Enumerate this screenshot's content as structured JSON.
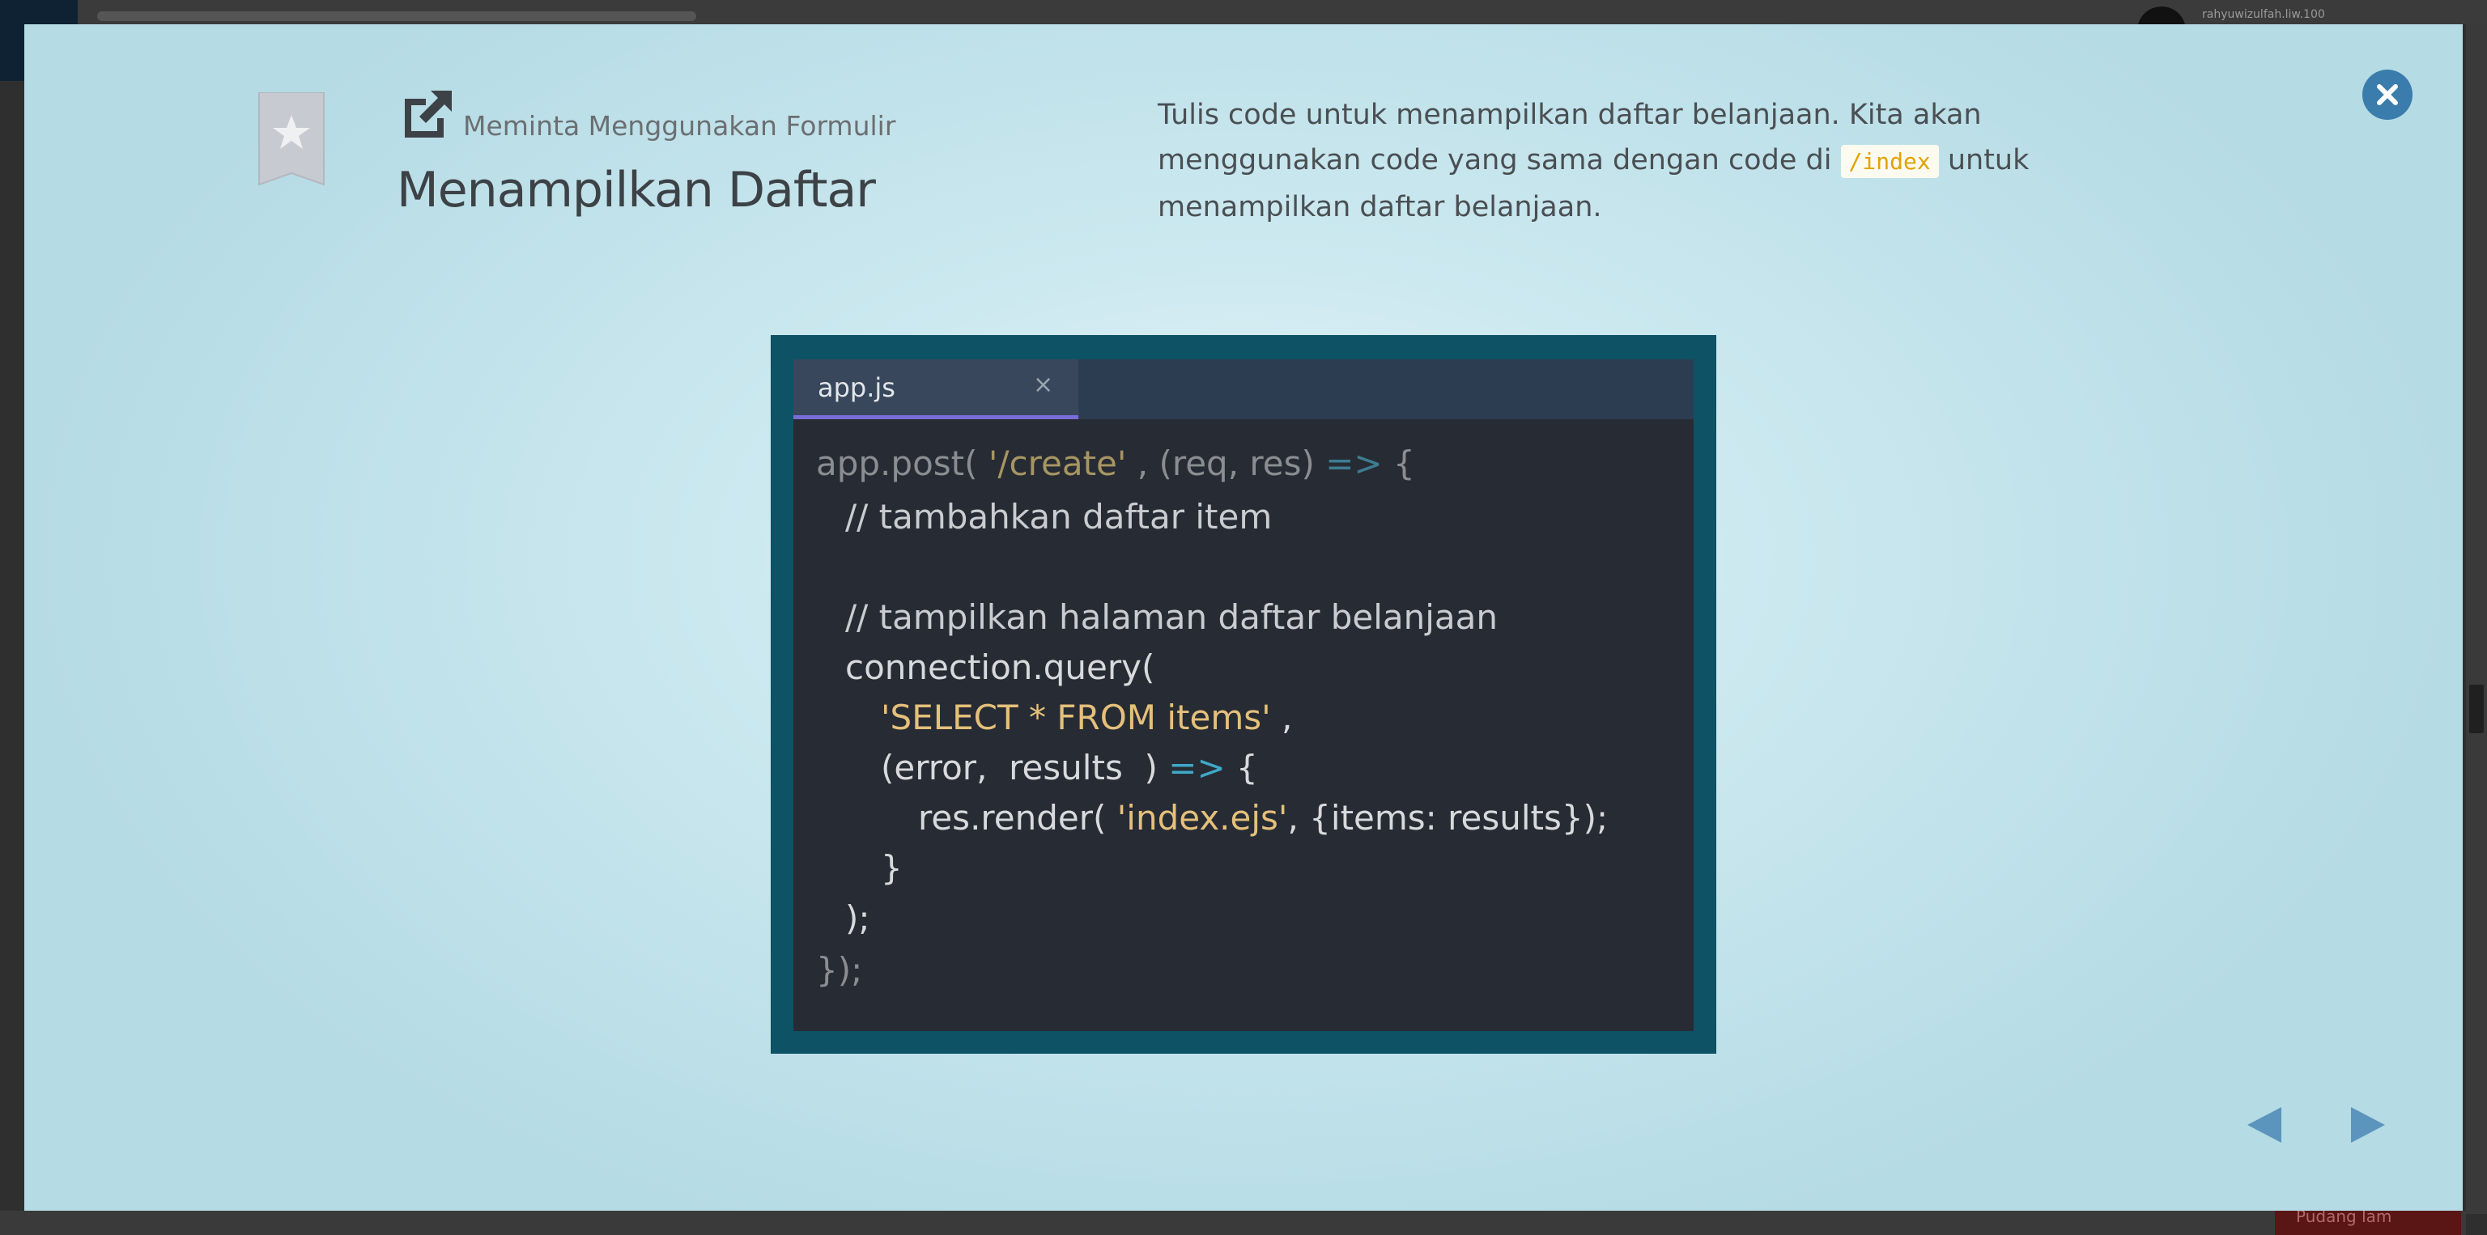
{
  "background": {
    "user_label": "rahyuwizulfah.liw.100",
    "bottom_button_label": "Pudang lam"
  },
  "lesson": {
    "subtitle": "Meminta Menggunakan Formulir",
    "title": "Menampilkan Daftar",
    "description_part1": "Tulis code untuk menampilkan daftar belanjaan. Kita akan menggunakan code yang sama dengan code di ",
    "description_code": "/index",
    "description_part2": " untuk menampilkan daftar belanjaan."
  },
  "code_editor": {
    "tab_label": "app.js",
    "tab_close": "×",
    "lines": {
      "l1_a": "app.post( ",
      "l1_b": "'/create'",
      "l1_c": " , (req, res) ",
      "l1_d": "=>",
      "l1_e": " {",
      "l2": "// tambahkan daftar item",
      "l3": "// tampilkan halaman daftar belanjaan",
      "l4": "connection.query(",
      "l5_a": "'SELECT * FROM items'",
      "l5_b": " ,",
      "l6_a": "(error,  results  ) ",
      "l6_b": "=>",
      "l6_c": " {",
      "l7_a": "res.render( ",
      "l7_b": "'index.ejs'",
      "l7_c": ", {items: results});",
      "l8": "}",
      "l9": ");",
      "l10": "});"
    }
  },
  "icons": {
    "bookmark": "bookmark-star-icon",
    "external": "external-link-icon",
    "close": "close-icon",
    "prev": "arrow-left-icon",
    "next": "arrow-right-icon"
  },
  "colors": {
    "accent": "#3a7cab",
    "code_frame": "#0e5266",
    "code_bg": "#272c34",
    "string": "#e5c07b",
    "arrow": "#3fa9c8"
  }
}
